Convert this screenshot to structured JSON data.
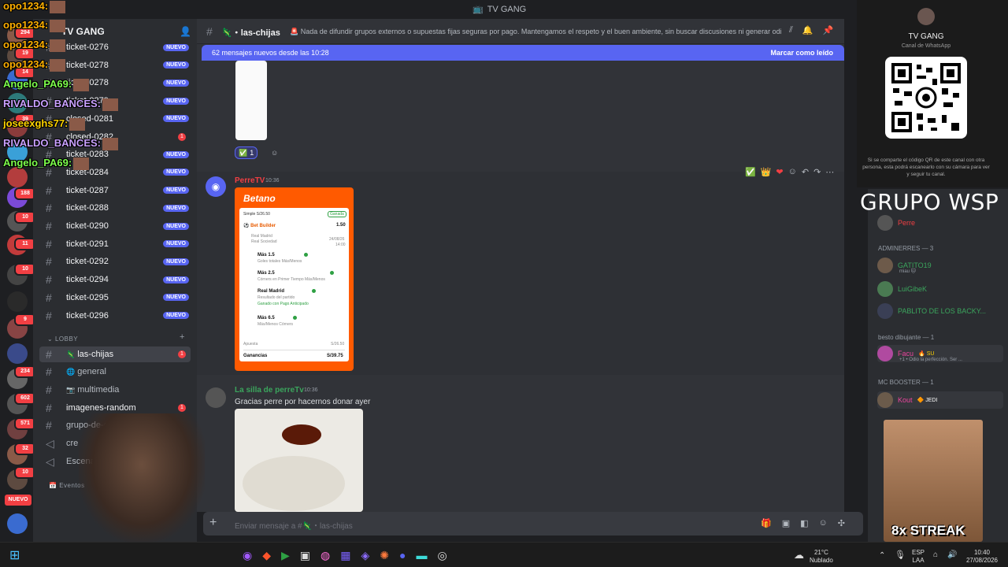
{
  "window": {
    "title": "TV GANG"
  },
  "server": {
    "name": "TV GANG"
  },
  "overlay_chat": [
    {
      "user": "opo1234:",
      "color": "#ffb000"
    },
    {
      "user": "opo1234:",
      "color": "#ffb000"
    },
    {
      "user": "opo1234:",
      "color": "#ffb000"
    },
    {
      "user": "opo1234:",
      "color": "#ffb000"
    },
    {
      "user": "Angelo_PA69:",
      "color": "#7dff4c"
    },
    {
      "user": "RIVALDO_BANCES:",
      "color": "#c9a0ff"
    },
    {
      "user": "joseexghs77:",
      "color": "#ffd400"
    },
    {
      "user": "RIVALDO_BANCES:",
      "color": "#c9a0ff"
    },
    {
      "user": "Angelo_PA69:",
      "color": "#7dff4c"
    }
  ],
  "rail_badges": [
    "294",
    "19",
    "14",
    "39",
    "188",
    "10",
    "11",
    "10",
    "9",
    "234",
    "602",
    "571",
    "32",
    "10"
  ],
  "rail_nuevo": "NUEVO",
  "channels": [
    {
      "name": "ticket-0276",
      "badge": "NUEVO"
    },
    {
      "name": "ticket-0278",
      "badge": "NUEVO"
    },
    {
      "name": "ticket-0278",
      "badge": "NUEVO"
    },
    {
      "name": "ticket-0279",
      "badge": "NUEVO"
    },
    {
      "name": "closed-0281",
      "badge": "NUEVO"
    },
    {
      "name": "closed-0282",
      "badge": "1"
    },
    {
      "name": "ticket-0283",
      "badge": "NUEVO"
    },
    {
      "name": "ticket-0284",
      "badge": "NUEVO"
    },
    {
      "name": "ticket-0287",
      "badge": "NUEVO"
    },
    {
      "name": "ticket-0288",
      "badge": "NUEVO"
    },
    {
      "name": "ticket-0290",
      "badge": "NUEVO"
    },
    {
      "name": "ticket-0291",
      "badge": "NUEVO"
    },
    {
      "name": "ticket-0292",
      "badge": "NUEVO"
    },
    {
      "name": "ticket-0294",
      "badge": "NUEVO"
    },
    {
      "name": "ticket-0295",
      "badge": "NUEVO"
    },
    {
      "name": "ticket-0296",
      "badge": "NUEVO"
    }
  ],
  "lobby": {
    "category": "LOBBY",
    "channels": [
      {
        "name": "las-chijas",
        "badge": "1",
        "emoji": "🦎"
      },
      {
        "name": "general",
        "badge": "",
        "emoji": "🌐"
      },
      {
        "name": "multimedia",
        "badge": "",
        "emoji": "📷"
      },
      {
        "name": "imagenes-random",
        "badge": "1",
        "emoji": ""
      },
      {
        "name": "grupo-de-c",
        "badge": "",
        "emoji": ""
      },
      {
        "name": "cre",
        "badge": "",
        "emoji": ""
      },
      {
        "name": "Escena",
        "badge": "",
        "emoji": ""
      }
    ],
    "events": "Eventos"
  },
  "chat": {
    "channel": "las-chijas",
    "topic": "🚨 Nada de difundir grupos externos o supuestas fijas seguras por pago. Mantengamos el respeto y el buen ambiente, sin buscar discusiones ni generar odi...",
    "newbar_text": "62 mensajes nuevos desde las 10:28",
    "newbar_action": "Marcar como leído",
    "reaction_count": "1",
    "msg1": {
      "author": "PerreTV",
      "time": "10:36"
    },
    "msg2": {
      "author": "La silla de perreTv",
      "time": "10:36",
      "text": "Gracias perre por hacernos donar ayer"
    },
    "composer_placeholder": "Enviar mensaje a #🦎・las-chijas"
  },
  "betano": {
    "brand": "Betano",
    "simple": "Simple S/26.50",
    "status": "Ganada",
    "builder": "Bet Builder",
    "builder_odds": "1.50",
    "match1": "Real Madrid",
    "match2": "Real Sociedad",
    "date": "24/08/26",
    "time": "14:00",
    "legs": [
      {
        "pick": "Más 1.5",
        "market": "Goles totales Más/Menos"
      },
      {
        "pick": "Más 2.5",
        "market": "Córners en Primer Tiempo Más/Menos"
      },
      {
        "pick": "Real Madrid",
        "market": "Resultado del partido",
        "note": "Ganado con Pago Anticipado"
      },
      {
        "pick": "Más 6.5",
        "market": "Más/Menos Córners"
      }
    ],
    "stake_label": "Apuesta",
    "stake": "S/26.50",
    "win_label": "Ganancias",
    "win": "S/39.75"
  },
  "qr": {
    "title": "TV GANG",
    "subtitle": "Canal de WhatsApp",
    "note": "Si se comparte el código QR de este canal con otra persona, esta podrá escanearlo con su cámara para ver y seguir tu canal."
  },
  "overlay_title": "GRUPO WSP",
  "members": {
    "owner": "Perre",
    "groups": [
      {
        "title": "ADMINERRES — 3",
        "members": [
          {
            "name": "GATITO19",
            "sub": "miau 🐱",
            "color": "#3ba55d"
          },
          {
            "name": "LuiGibeK",
            "sub": "",
            "color": "#3ba55d"
          },
          {
            "name": "PABLITO DE LOS BACKY...",
            "sub": "",
            "color": "#3ba55d"
          }
        ]
      },
      {
        "title": "besto dibujante — 1",
        "members": [
          {
            "name": "Facu",
            "tag": "SU",
            "sub": "+1 • Odio la perfección. Ser ...",
            "color": "#eb459e"
          }
        ]
      },
      {
        "title": "MC BOOSTER — 1",
        "members": [
          {
            "name": "Kout",
            "tag": "JEDI",
            "sub": "",
            "color": "#eb459e"
          }
        ]
      }
    ]
  },
  "streak": "8x STREAK",
  "taskbar": {
    "weather_temp": "21°C",
    "weather_desc": "Nublado",
    "lang": "ESP",
    "region": "LAA",
    "time": "10:40",
    "date": "27/08/2026"
  }
}
